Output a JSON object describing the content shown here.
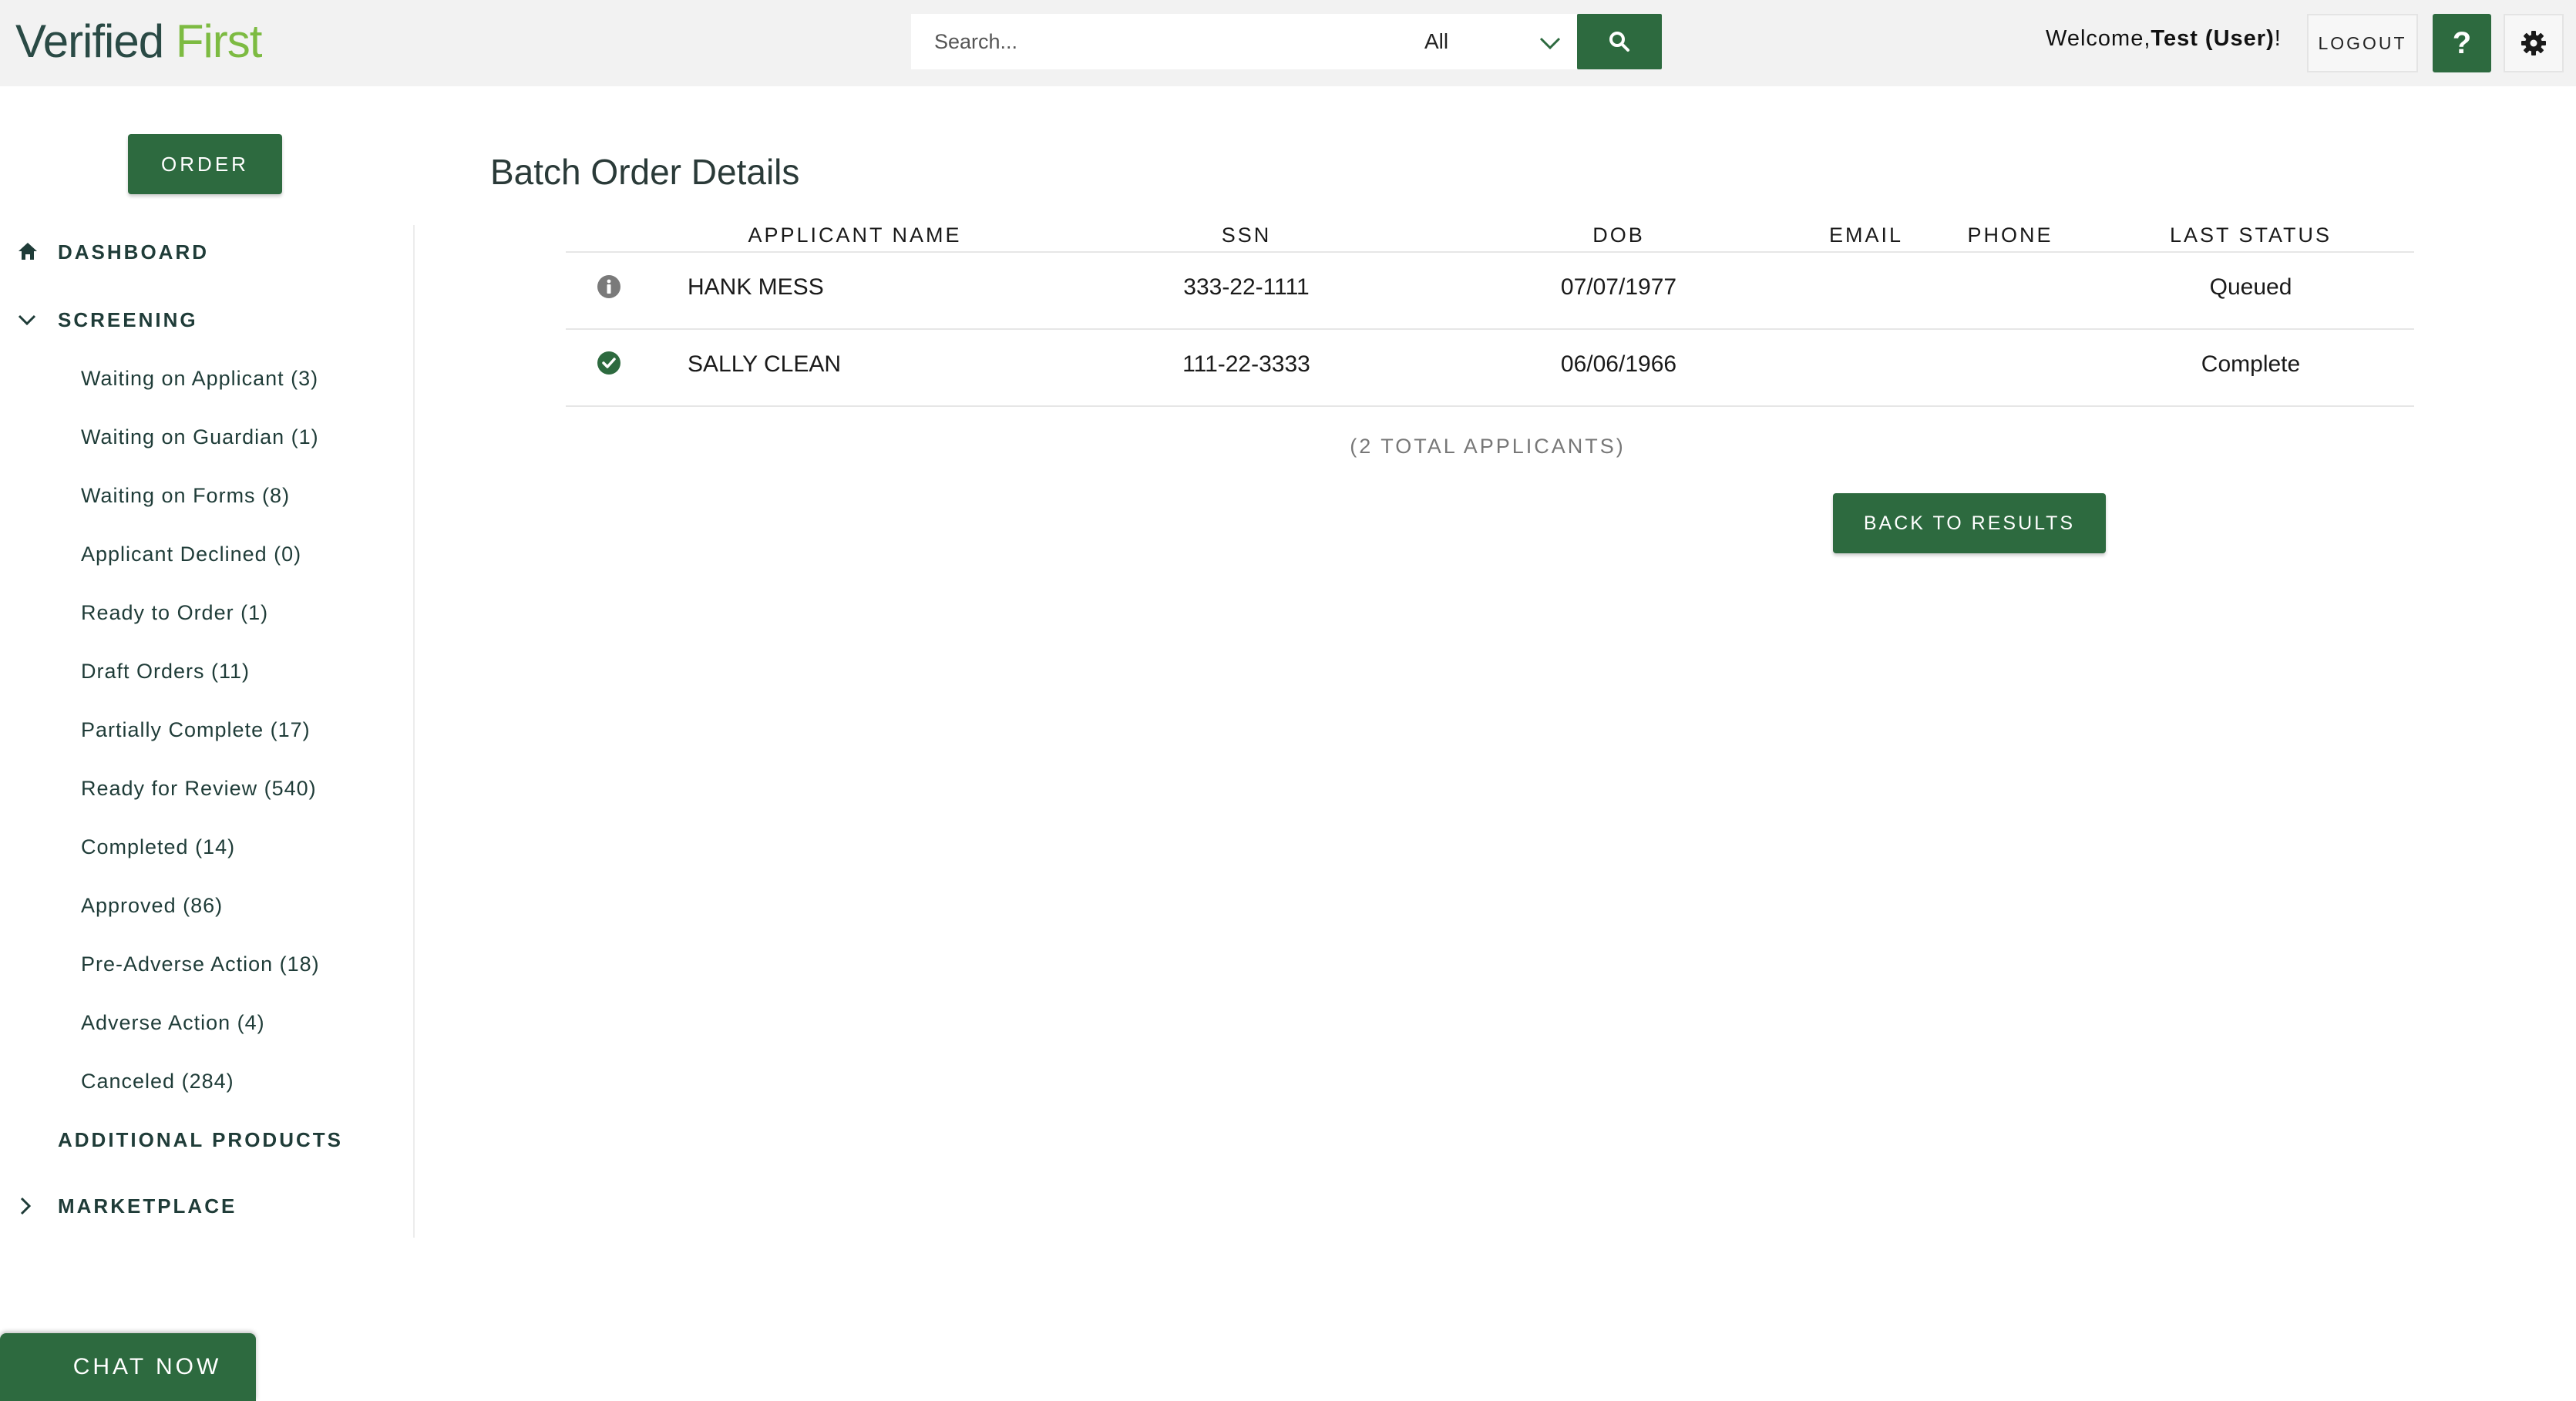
{
  "header": {
    "logo_word1": "Verified",
    "logo_word2": "First",
    "search_placeholder": "Search...",
    "search_scope": "All",
    "welcome_prefix": "Welcome,",
    "welcome_user": "Test (User)",
    "welcome_suffix": "!",
    "logout_label": "LOGOUT",
    "help_label": "?"
  },
  "sidebar": {
    "order_label": "ORDER",
    "dashboard_label": "DASHBOARD",
    "screening_label": "SCREENING",
    "screening_items": [
      {
        "label": "Waiting on Applicant (3)"
      },
      {
        "label": "Waiting on Guardian (1)"
      },
      {
        "label": "Waiting on Forms (8)"
      },
      {
        "label": "Applicant Declined (0)"
      },
      {
        "label": "Ready to Order (1)"
      },
      {
        "label": "Draft Orders (11)"
      },
      {
        "label": "Partially Complete (17)"
      },
      {
        "label": "Ready for Review (540)"
      },
      {
        "label": "Completed (14)"
      },
      {
        "label": "Approved (86)"
      },
      {
        "label": "Pre-Adverse Action (18)"
      },
      {
        "label": "Adverse Action (4)"
      },
      {
        "label": "Canceled (284)"
      }
    ],
    "additional_products_label": "ADDITIONAL PRODUCTS",
    "marketplace_label": "MARKETPLACE"
  },
  "main": {
    "title": "Batch Order Details",
    "columns": [
      "APPLICANT NAME",
      "SSN",
      "DOB",
      "EMAIL",
      "PHONE",
      "LAST STATUS"
    ],
    "rows": [
      {
        "icon": "info-icon",
        "name": "HANK MESS",
        "ssn": "333-22-1111",
        "dob": "07/07/1977",
        "email": "",
        "phone": "",
        "status": "Queued"
      },
      {
        "icon": "check-circle-icon",
        "name": "SALLY CLEAN",
        "ssn": "111-22-3333",
        "dob": "06/06/1966",
        "email": "",
        "phone": "",
        "status": "Complete"
      }
    ],
    "total_label": "(2 TOTAL APPLICANTS)",
    "back_label": "BACK TO RESULTS"
  },
  "chat": {
    "label": "CHAT NOW"
  },
  "colors": {
    "brand_green": "#2d6a3f",
    "logo_green": "#7dbb42",
    "text_dark": "#1f3c38"
  }
}
